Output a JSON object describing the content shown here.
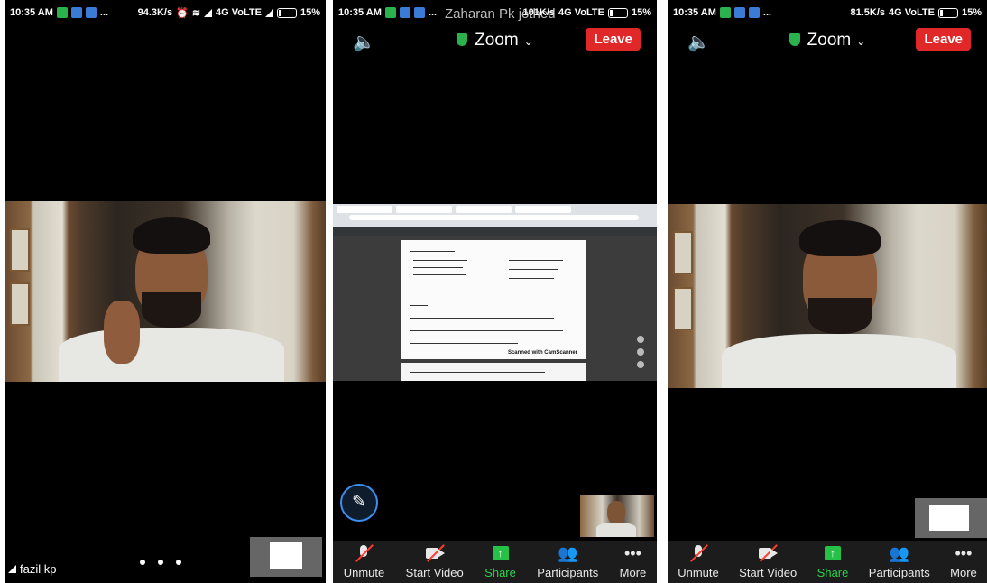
{
  "panels": [
    {
      "status": {
        "time": "10:35 AM",
        "notifications": "...",
        "speed": "94.3K/s",
        "network": "4G VoLTE",
        "battery": "15%"
      },
      "participant_name": "fazil kp"
    },
    {
      "status": {
        "time": "10:35 AM",
        "notifications": "...",
        "speed": "101K/s",
        "network": "4G VoLTE",
        "battery": "15%"
      },
      "overlay_name": "Zaharan Pk jothed",
      "meeting_title": "Zoom",
      "leave_label": "Leave",
      "shared_doc": {
        "scanned_label": "Scanned with CamScanner"
      },
      "toolbar": {
        "unmute": "Unmute",
        "start_video": "Start Video",
        "share": "Share",
        "participants": "Participants",
        "more": "More"
      }
    },
    {
      "status": {
        "time": "10:35 AM",
        "notifications": "...",
        "speed": "81.5K/s",
        "network": "4G VoLTE",
        "battery": "15%"
      },
      "meeting_title": "Zoom",
      "leave_label": "Leave",
      "toolbar": {
        "unmute": "Unmute",
        "start_video": "Start Video",
        "share": "Share",
        "participants": "Participants",
        "more": "More"
      }
    }
  ],
  "colors": {
    "leave": "#e02828",
    "share_green": "#26c248",
    "shield": "#2bb24c",
    "pen_ring": "#3d8ef0"
  },
  "icons": [
    "speaker-icon",
    "shield-icon",
    "chevron-down-icon",
    "mic-muted-icon",
    "video-off-icon",
    "share-up-icon",
    "participants-icon",
    "more-icon",
    "pen-icon"
  ]
}
